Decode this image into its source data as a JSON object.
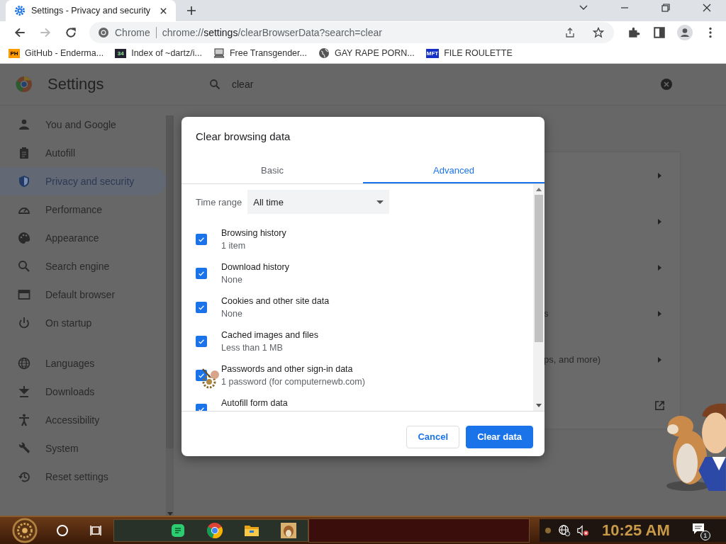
{
  "browser": {
    "tabs": [
      {
        "title": "Settings - Privacy and security",
        "selected": true
      }
    ],
    "address": {
      "site_label": "Chrome",
      "url": "chrome://**settings**/clearBrowserData?search=clear"
    },
    "bookmarks": [
      {
        "kind": "text-favicon",
        "favicon_text": "PH",
        "title": "GitHub - Enderma..."
      },
      {
        "kind": "text-favicon",
        "favicon_text": "34",
        "title": "Index of ~dartz/i..."
      },
      {
        "kind": "computer",
        "title": "Free Transgender..."
      },
      {
        "kind": "globe",
        "title": "GAY RAPE PORN..."
      },
      {
        "kind": "text-favicon",
        "favicon_text": "MFT",
        "title": "FILE ROULETTE"
      }
    ]
  },
  "settings": {
    "title": "Settings",
    "search": {
      "value": "clear"
    },
    "sidebar": {
      "items": [
        {
          "label": "You and Google",
          "selected": false
        },
        {
          "label": "Autofill",
          "selected": false
        },
        {
          "label": "Privacy and security",
          "selected": true
        },
        {
          "label": "Performance",
          "selected": false
        },
        {
          "label": "Appearance",
          "selected": false
        },
        {
          "label": "Search engine",
          "selected": false
        },
        {
          "label": "Default browser",
          "selected": false
        },
        {
          "label": "On startup",
          "selected": false
        },
        {
          "label": "Languages",
          "selected": false
        },
        {
          "label": "Downloads",
          "selected": false
        },
        {
          "label": "Accessibility",
          "selected": false
        },
        {
          "label": "System",
          "selected": false
        },
        {
          "label": "Reset settings",
          "selected": false
        }
      ]
    },
    "card_rows": [
      {
        "kind": "submenu"
      },
      {
        "kind": "submenu"
      },
      {
        "kind": "submenu"
      },
      {
        "text_fragment": "s",
        "kind": "submenu"
      },
      {
        "text_fragment": "ps, and more)",
        "kind": "submenu"
      },
      {
        "kind": "external"
      }
    ]
  },
  "dialog": {
    "title": "Clear browsing data",
    "tabs": [
      {
        "label": "Basic",
        "selected": false
      },
      {
        "label": "Advanced",
        "selected": true
      }
    ],
    "time_range": {
      "label": "Time range",
      "value": "All time"
    },
    "items": [
      {
        "title": "Browsing history",
        "detail": "1 item",
        "checked": true
      },
      {
        "title": "Download history",
        "detail": "None",
        "checked": true
      },
      {
        "title": "Cookies and other site data",
        "detail": "None",
        "checked": true
      },
      {
        "title": "Cached images and files",
        "detail": "Less than 1 MB",
        "checked": true
      },
      {
        "title": "Passwords and other sign-in data",
        "detail": "1 password (for computernewb.com)",
        "checked": true
      },
      {
        "title": "Autofill form data",
        "checked": true
      }
    ],
    "buttons": [
      {
        "label": "Cancel",
        "kind": "secondary"
      },
      {
        "label": "Clear data",
        "kind": "primary"
      }
    ]
  },
  "taskbar": {
    "apps": [
      {
        "kind": "chat"
      },
      {
        "kind": "chrome"
      },
      {
        "kind": "folder"
      },
      {
        "kind": "game"
      }
    ],
    "clock": "10:25 AM",
    "notification_count": "1"
  }
}
